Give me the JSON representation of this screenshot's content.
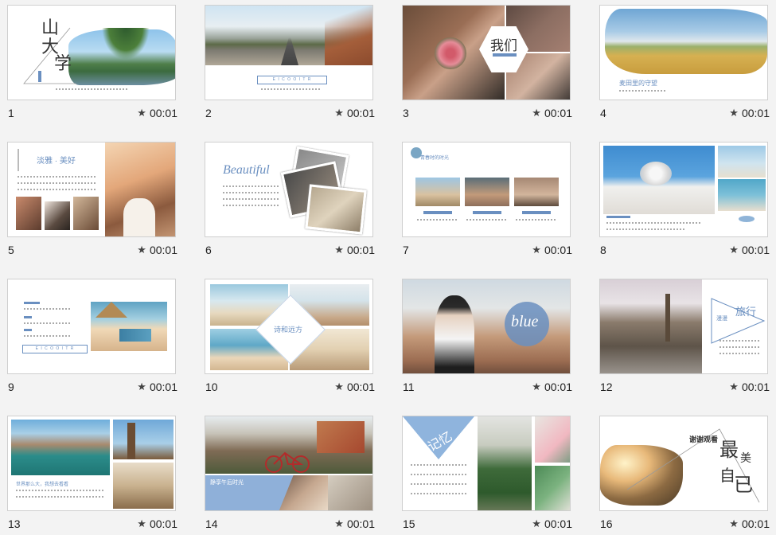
{
  "slides": [
    {
      "num": "1",
      "duration": "00:01",
      "title_chars": [
        "山",
        "大",
        "学"
      ]
    },
    {
      "num": "2",
      "duration": "00:01",
      "button": "E I C O O I T R"
    },
    {
      "num": "3",
      "duration": "00:01",
      "title": "我们"
    },
    {
      "num": "4",
      "duration": "00:01",
      "caption": "麦田里的守望"
    },
    {
      "num": "5",
      "duration": "00:01",
      "title": "淡雅 · 美好"
    },
    {
      "num": "6",
      "duration": "00:01",
      "title": "Beautiful"
    },
    {
      "num": "7",
      "duration": "00:01",
      "caption": "青春时的时光"
    },
    {
      "num": "8",
      "duration": "00:01"
    },
    {
      "num": "9",
      "duration": "00:01",
      "button": "E I C O O I T R"
    },
    {
      "num": "10",
      "duration": "00:01",
      "caption": "诗和远方"
    },
    {
      "num": "11",
      "duration": "00:01",
      "title": "blue"
    },
    {
      "num": "12",
      "duration": "00:01",
      "title": "旅行",
      "subtitle": "漫漫"
    },
    {
      "num": "13",
      "duration": "00:01",
      "caption": "世界那么大，我想去看看"
    },
    {
      "num": "14",
      "duration": "00:01",
      "caption": "静享午后时光"
    },
    {
      "num": "15",
      "duration": "00:01",
      "title": "记忆"
    },
    {
      "num": "16",
      "duration": "00:01",
      "title_a": "谢谢观看",
      "title_b": "最",
      "title_c": "美",
      "title_d": "自",
      "title_e": "已"
    }
  ],
  "colors": {
    "accent": "#6a8fc0",
    "background": "#f3f3f3"
  },
  "icons": {
    "duration": "star-icon"
  }
}
